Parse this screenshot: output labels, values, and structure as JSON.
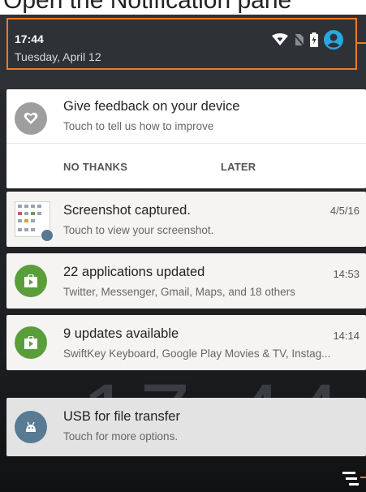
{
  "caption": {
    "text": "Open the Notification pane"
  },
  "status": {
    "time": "17:44",
    "date": "Tuesday, April 12"
  },
  "status_icons": [
    "wifi-icon",
    "no-sim-icon",
    "battery-icon",
    "account-icon"
  ],
  "notifications": {
    "feedback": {
      "title": "Give feedback on your device",
      "subtitle": "Touch to tell us how to improve",
      "actions": [
        "NO THANKS",
        "LATER"
      ],
      "icon": "heart-icon"
    },
    "screenshot": {
      "title": "Screenshot captured.",
      "subtitle": "Touch to view your screenshot.",
      "time": "4/5/16"
    },
    "apps_updated": {
      "title": "22 applications updated",
      "subtitle": "Twitter, Messenger, Gmail, Maps, and 18 others",
      "time": "14:53",
      "icon": "play-store-icon"
    },
    "updates_available": {
      "title": "9 updates available",
      "subtitle": "SwiftKey Keyboard, Google Play Movies & TV, Instag...",
      "time": "14:14",
      "icon": "play-store-icon"
    },
    "usb": {
      "title": "USB for file transfer",
      "subtitle": "Touch for more options.",
      "icon": "android-icon"
    }
  },
  "wallpaper_clock": "17:44",
  "colors": {
    "highlight": "#f07a28",
    "header_bg": "#2e3236",
    "green": "#5a9e3a",
    "feedback_gray": "#9e9e9e",
    "usb_blue": "#587a92",
    "account_blue": "#29a8e0"
  }
}
